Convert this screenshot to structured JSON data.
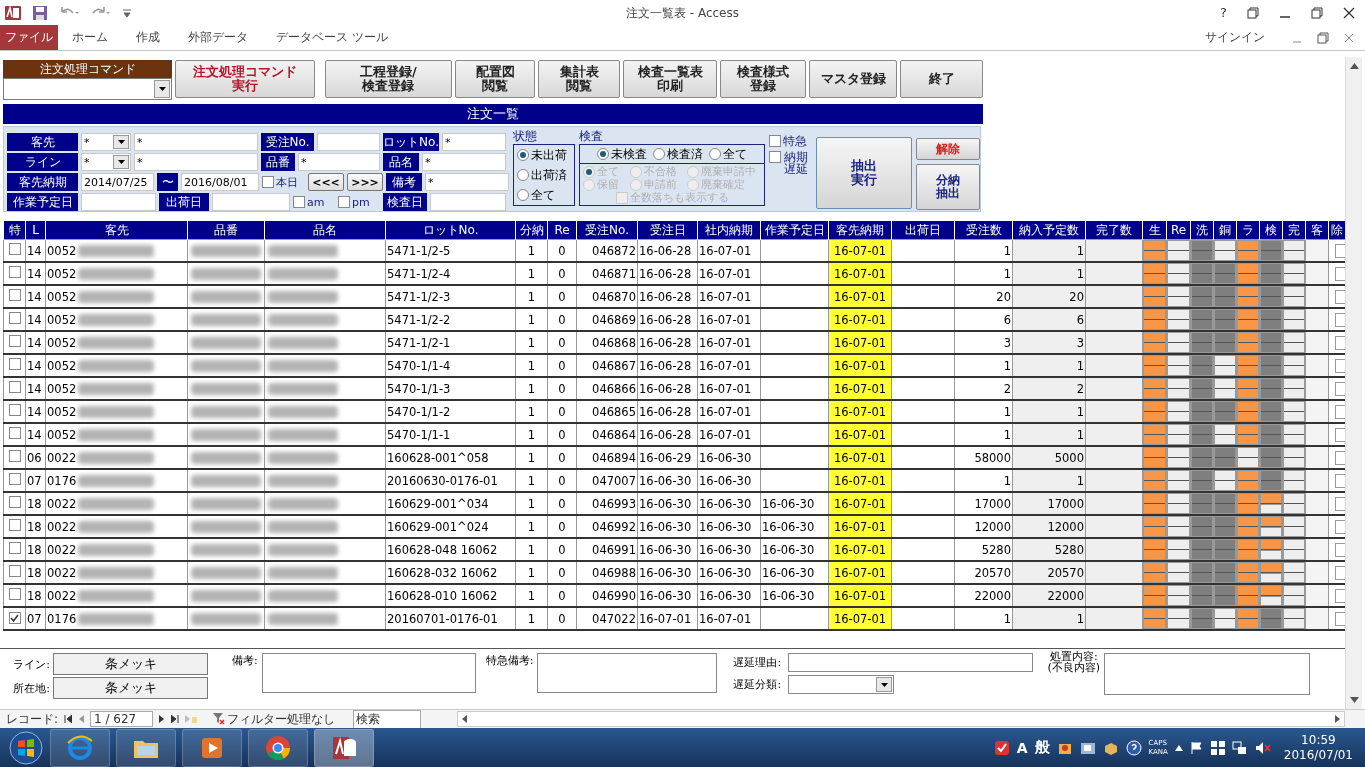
{
  "window": {
    "title": "注文一覧表 - Access",
    "help": "?",
    "signin": "サインイン"
  },
  "ribbon_tabs": [
    {
      "label": "ファイル",
      "selected": true
    },
    {
      "label": "ホーム",
      "selected": false
    },
    {
      "label": "作成",
      "selected": false
    },
    {
      "label": "外部データ",
      "selected": false
    },
    {
      "label": "データベース ツール",
      "selected": false
    }
  ],
  "command": {
    "label": "注文処理コマンド",
    "buttons": [
      {
        "label": "注文処理コマンド実行",
        "kind": "alert"
      },
      {
        "label": "工程登録/検査登録",
        "kind": "normal"
      },
      {
        "label": "配置図閲覧",
        "kind": "normal"
      },
      {
        "label": "集計表閲覧",
        "kind": "normal"
      },
      {
        "label": "検査一覧表印刷",
        "kind": "normal"
      },
      {
        "label": "検査様式登録",
        "kind": "normal"
      },
      {
        "label": "マスタ登録",
        "kind": "normal"
      },
      {
        "label": "終了",
        "kind": "normal"
      }
    ]
  },
  "form_title": "注文一覧",
  "filters": {
    "customer": {
      "label": "客先",
      "code": "*",
      "name": "*"
    },
    "line": {
      "label": "ライン",
      "code": "*",
      "name": "*"
    },
    "order_no": {
      "label": "受注No."
    },
    "lot_no": {
      "label": "ロットNo.",
      "value": "*"
    },
    "part_no": {
      "label": "品番",
      "value": "*"
    },
    "part_name": {
      "label": "品名",
      "value": "*"
    },
    "due": {
      "label": "客先納期",
      "from": "2014/07/25",
      "sep": "〜",
      "to": "2016/08/01"
    },
    "today": {
      "label": "本日",
      "checked": false
    },
    "prev": "<<<",
    "next": ">>>",
    "remarks": {
      "label": "備考",
      "value": "*"
    },
    "work_date": {
      "label": "作業予定日"
    },
    "ship_date": {
      "label": "出荷日"
    },
    "am": {
      "label": "am",
      "checked": false
    },
    "pm": {
      "label": "pm",
      "checked": false
    },
    "inspect_date": {
      "label": "検査日"
    }
  },
  "status": {
    "title": "状態",
    "options": [
      {
        "label": "未出荷",
        "selected": true
      },
      {
        "label": "出荷済",
        "selected": false
      },
      {
        "label": "全て",
        "selected": false
      }
    ]
  },
  "inspection": {
    "title": "検査",
    "options": [
      {
        "label": "未検査",
        "selected": true
      },
      {
        "label": "検査済",
        "selected": false
      },
      {
        "label": "全て",
        "selected": false
      }
    ],
    "detail": {
      "disabled": true,
      "options": [
        {
          "label": "全て",
          "selected": true
        },
        {
          "label": "不合格",
          "selected": false
        },
        {
          "label": "廃棄申請中",
          "selected": false
        },
        {
          "label": "保留",
          "selected": false
        },
        {
          "label": "申請前",
          "selected": false
        },
        {
          "label": "廃棄確定",
          "selected": false
        }
      ],
      "show_all": {
        "label": "全数落ちも表示する",
        "checked": false
      }
    }
  },
  "flags": [
    {
      "label": "特急",
      "checked": false
    },
    {
      "label": "納期遅延",
      "checked": false
    }
  ],
  "run_button": "抽出実行",
  "clear_button": "解除",
  "split_button": "分納抽出",
  "columns": [
    "特",
    "L",
    "客先",
    "品番",
    "品名",
    "ロットNo.",
    "分納",
    "Re",
    "受注No.",
    "受注日",
    "社内納期",
    "作業予定日",
    "客先納期",
    "出荷日",
    "受注数",
    "納入予定数",
    "完了数",
    "生",
    "Re",
    "洗",
    "銅",
    "ラ",
    "検",
    "完",
    "客",
    "除"
  ],
  "rows": [
    {
      "rush": false,
      "line": "14",
      "code": "0052",
      "lot": "5471-1/2-5",
      "split": "1",
      "re": "0",
      "order_no": "046872",
      "order_date": "16-06-28",
      "internal_due": "16-07-01",
      "customer_due": "16-07-01",
      "qty": "1",
      "planned": "1",
      "remove": false,
      "stages": [
        {
          "color": "#f79646"
        },
        {
          "color": "#eeeeee"
        },
        {
          "color": "#7f7f7f"
        },
        {
          "color": "#eeeeee"
        },
        {
          "color": "#f79646"
        },
        {
          "color": "#7f7f7f"
        },
        {
          "color": "#eeeeee"
        }
      ]
    },
    {
      "rush": false,
      "line": "14",
      "code": "0052",
      "lot": "5471-1/2-4",
      "split": "1",
      "re": "0",
      "order_no": "046871",
      "order_date": "16-06-28",
      "internal_due": "16-07-01",
      "customer_due": "16-07-01",
      "qty": "1",
      "planned": "1",
      "remove": false,
      "stages": [
        {
          "color": "#f79646"
        },
        {
          "color": "#eeeeee"
        },
        {
          "color": "#7f7f7f"
        },
        {
          "color": "#7f7f7f"
        },
        {
          "color": "#f79646"
        },
        {
          "color": "#7f7f7f"
        },
        {
          "color": "#eeeeee"
        }
      ]
    },
    {
      "rush": false,
      "line": "14",
      "code": "0052",
      "lot": "5471-1/2-3",
      "split": "1",
      "re": "0",
      "order_no": "046870",
      "order_date": "16-06-28",
      "internal_due": "16-07-01",
      "customer_due": "16-07-01",
      "qty": "20",
      "planned": "20",
      "remove": false,
      "stages": [
        {
          "color": "#f79646"
        },
        {
          "color": "#eeeeee"
        },
        {
          "color": "#7f7f7f"
        },
        {
          "color": "#7f7f7f"
        },
        {
          "color": "#f79646"
        },
        {
          "color": "#7f7f7f"
        },
        {
          "color": "#eeeeee"
        }
      ]
    },
    {
      "rush": false,
      "line": "14",
      "code": "0052",
      "lot": "5471-1/2-2",
      "split": "1",
      "re": "0",
      "order_no": "046869",
      "order_date": "16-06-28",
      "internal_due": "16-07-01",
      "customer_due": "16-07-01",
      "qty": "6",
      "planned": "6",
      "remove": false,
      "stages": [
        {
          "color": "#f79646"
        },
        {
          "color": "#eeeeee"
        },
        {
          "color": "#7f7f7f"
        },
        {
          "color": "#7f7f7f"
        },
        {
          "color": "#f79646"
        },
        {
          "color": "#7f7f7f"
        },
        {
          "color": "#eeeeee"
        }
      ]
    },
    {
      "rush": false,
      "line": "14",
      "code": "0052",
      "lot": "5471-1/2-1",
      "split": "1",
      "re": "0",
      "order_no": "046868",
      "order_date": "16-06-28",
      "internal_due": "16-07-01",
      "customer_due": "16-07-01",
      "qty": "3",
      "planned": "3",
      "remove": false,
      "stages": [
        {
          "color": "#f79646"
        },
        {
          "color": "#eeeeee"
        },
        {
          "color": "#7f7f7f"
        },
        {
          "color": "#7f7f7f"
        },
        {
          "color": "#f79646"
        },
        {
          "color": "#7f7f7f"
        },
        {
          "color": "#eeeeee"
        }
      ]
    },
    {
      "rush": false,
      "line": "14",
      "code": "0052",
      "lot": "5470-1/1-4",
      "split": "1",
      "re": "0",
      "order_no": "046867",
      "order_date": "16-06-28",
      "internal_due": "16-07-01",
      "customer_due": "16-07-01",
      "qty": "1",
      "planned": "1",
      "remove": false,
      "stages": [
        {
          "color": "#f79646"
        },
        {
          "color": "#eeeeee"
        },
        {
          "color": "#7f7f7f"
        },
        {
          "color": "#eeeeee"
        },
        {
          "color": "#f79646"
        },
        {
          "color": "#7f7f7f"
        },
        {
          "color": "#eeeeee"
        }
      ]
    },
    {
      "rush": false,
      "line": "14",
      "code": "0052",
      "lot": "5470-1/1-3",
      "split": "1",
      "re": "0",
      "order_no": "046866",
      "order_date": "16-06-28",
      "internal_due": "16-07-01",
      "customer_due": "16-07-01",
      "qty": "2",
      "planned": "2",
      "remove": false,
      "stages": [
        {
          "color": "#f79646"
        },
        {
          "color": "#eeeeee"
        },
        {
          "color": "#7f7f7f"
        },
        {
          "color": "#eeeeee"
        },
        {
          "color": "#f79646"
        },
        {
          "color": "#7f7f7f"
        },
        {
          "color": "#eeeeee"
        }
      ]
    },
    {
      "rush": false,
      "line": "14",
      "code": "0052",
      "lot": "5470-1/1-2",
      "split": "1",
      "re": "0",
      "order_no": "046865",
      "order_date": "16-06-28",
      "internal_due": "16-07-01",
      "customer_due": "16-07-01",
      "qty": "1",
      "planned": "1",
      "remove": false,
      "stages": [
        {
          "color": "#f79646"
        },
        {
          "color": "#eeeeee"
        },
        {
          "color": "#7f7f7f"
        },
        {
          "color": "#7f7f7f"
        },
        {
          "color": "#f79646"
        },
        {
          "color": "#7f7f7f"
        },
        {
          "color": "#eeeeee"
        }
      ]
    },
    {
      "rush": false,
      "line": "14",
      "code": "0052",
      "lot": "5470-1/1-1",
      "split": "1",
      "re": "0",
      "order_no": "046864",
      "order_date": "16-06-28",
      "internal_due": "16-07-01",
      "customer_due": "16-07-01",
      "qty": "1",
      "planned": "1",
      "remove": false,
      "stages": [
        {
          "color": "#f79646"
        },
        {
          "color": "#eeeeee"
        },
        {
          "color": "#7f7f7f"
        },
        {
          "color": "#eeeeee"
        },
        {
          "color": "#f79646"
        },
        {
          "color": "#7f7f7f"
        },
        {
          "color": "#eeeeee"
        }
      ]
    },
    {
      "rush": false,
      "line": "06",
      "code": "0022",
      "lot": "160628-001^058",
      "split": "1",
      "re": "0",
      "order_no": "046894",
      "order_date": "16-06-29",
      "internal_due": "16-06-30",
      "customer_due": "16-07-01",
      "qty": "58000",
      "planned": "5000",
      "remove": false,
      "stages": [
        {
          "color": "#f79646"
        },
        {
          "color": "#eeeeee"
        },
        {
          "color": "#7f7f7f"
        },
        {
          "color": "#7f7f7f"
        },
        {
          "color": "#eeeeee"
        },
        {
          "color": "#7f7f7f"
        },
        {
          "color": "#eeeeee"
        }
      ]
    },
    {
      "rush": false,
      "line": "07",
      "code": "0176",
      "lot": "20160630-0176-01",
      "split": "1",
      "re": "0",
      "order_no": "047007",
      "order_date": "16-06-30",
      "internal_due": "16-06-30",
      "customer_due": "16-07-01",
      "qty": "1",
      "planned": "1",
      "remove": false,
      "stages": [
        {
          "color": "#f79646"
        },
        {
          "color": "#eeeeee"
        },
        {
          "color": "#7f7f7f"
        },
        {
          "color": "#eeeeee"
        },
        {
          "color": "#f79646"
        },
        {
          "color": "#7f7f7f"
        },
        {
          "color": "#eeeeee"
        }
      ]
    },
    {
      "rush": false,
      "line": "18",
      "code": "0022",
      "lot": "160629-001^034",
      "split": "1",
      "re": "0",
      "order_no": "046993",
      "order_date": "16-06-30",
      "internal_due": "16-06-30",
      "work_date": "16-06-30",
      "customer_due": "16-07-01",
      "qty": "17000",
      "planned": "17000",
      "remove": false,
      "stages": [
        {
          "color": "#f79646"
        },
        {
          "color": "#eeeeee"
        },
        {
          "color": "#7f7f7f"
        },
        {
          "color": "#7f7f7f"
        },
        {
          "color": "#f79646"
        },
        {
          "halves": [
            {
              "color": "#f79646"
            },
            {
              "color": "#eeeeee"
            }
          ]
        },
        {
          "color": "#eeeeee"
        }
      ]
    },
    {
      "rush": false,
      "line": "18",
      "code": "0022",
      "lot": "160629-001^024",
      "split": "1",
      "re": "0",
      "order_no": "046992",
      "order_date": "16-06-30",
      "internal_due": "16-06-30",
      "work_date": "16-06-30",
      "customer_due": "16-07-01",
      "qty": "12000",
      "planned": "12000",
      "remove": false,
      "stages": [
        {
          "color": "#f79646"
        },
        {
          "color": "#eeeeee"
        },
        {
          "color": "#7f7f7f"
        },
        {
          "color": "#7f7f7f"
        },
        {
          "color": "#f79646"
        },
        {
          "halves": [
            {
              "color": "#f79646"
            },
            {
              "color": "#eeeeee"
            }
          ]
        },
        {
          "color": "#eeeeee"
        }
      ]
    },
    {
      "rush": false,
      "line": "18",
      "code": "0022",
      "lot": "160628-048 16062",
      "split": "1",
      "re": "0",
      "order_no": "046991",
      "order_date": "16-06-30",
      "internal_due": "16-06-30",
      "work_date": "16-06-30",
      "customer_due": "16-07-01",
      "qty": "5280",
      "planned": "5280",
      "remove": false,
      "stages": [
        {
          "color": "#f79646"
        },
        {
          "color": "#eeeeee"
        },
        {
          "color": "#7f7f7f"
        },
        {
          "color": "#7f7f7f"
        },
        {
          "color": "#f79646"
        },
        {
          "halves": [
            {
              "color": "#f79646"
            },
            {
              "color": "#eeeeee"
            }
          ]
        },
        {
          "color": "#eeeeee"
        }
      ]
    },
    {
      "rush": false,
      "line": "18",
      "code": "0022",
      "lot": "160628-032 16062",
      "split": "1",
      "re": "0",
      "order_no": "046988",
      "order_date": "16-06-30",
      "internal_due": "16-06-30",
      "work_date": "16-06-30",
      "customer_due": "16-07-01",
      "qty": "20570",
      "planned": "20570",
      "remove": false,
      "stages": [
        {
          "color": "#f79646"
        },
        {
          "color": "#eeeeee"
        },
        {
          "color": "#7f7f7f"
        },
        {
          "color": "#7f7f7f"
        },
        {
          "color": "#f79646"
        },
        {
          "halves": [
            {
              "color": "#f79646"
            },
            {
              "color": "#eeeeee"
            }
          ]
        },
        {
          "color": "#eeeeee"
        }
      ]
    },
    {
      "rush": false,
      "line": "18",
      "code": "0022",
      "lot": "160628-010 16062",
      "split": "1",
      "re": "0",
      "order_no": "046990",
      "order_date": "16-06-30",
      "internal_due": "16-06-30",
      "work_date": "16-06-30",
      "customer_due": "16-07-01",
      "qty": "22000",
      "planned": "22000",
      "remove": false,
      "stages": [
        {
          "color": "#f79646"
        },
        {
          "color": "#eeeeee"
        },
        {
          "color": "#7f7f7f"
        },
        {
          "color": "#7f7f7f"
        },
        {
          "color": "#f79646"
        },
        {
          "halves": [
            {
              "color": "#f79646"
            },
            {
              "color": "#eeeeee"
            }
          ]
        },
        {
          "color": "#eeeeee"
        }
      ]
    },
    {
      "rush": true,
      "line": "07",
      "code": "0176",
      "lot": "20160701-0176-01",
      "split": "1",
      "re": "0",
      "order_no": "047022",
      "order_date": "16-07-01",
      "internal_due": "16-07-01",
      "customer_due": "16-07-01",
      "qty": "1",
      "planned": "1",
      "remove": false,
      "stages": [
        {
          "color": "#f79646"
        },
        {
          "color": "#eeeeee"
        },
        {
          "color": "#7f7f7f"
        },
        {
          "color": "#eeeeee"
        },
        {
          "color": "#f79646"
        },
        {
          "color": "#7f7f7f"
        },
        {
          "color": "#eeeeee"
        }
      ]
    }
  ],
  "detail": {
    "line": {
      "label": "ライン:",
      "value": "条メッキ"
    },
    "location": {
      "label": "所在地:",
      "value": "条メッキ"
    },
    "remarks": "備考:",
    "rush_remarks": "特急備考:",
    "delay_reason": "遅延理由:",
    "delay_type": "遅延分類:",
    "action": "処置内容:\n(不良内容)"
  },
  "record_nav": {
    "label": "レコード:",
    "position": "1 / 627",
    "filter": "フィルター処理なし",
    "search": "検索"
  },
  "taskbar": {
    "ime": [
      "A",
      "般"
    ],
    "caps": "CAPS",
    "kana": "KANA",
    "time": "10:59",
    "date": "2016/07/01"
  }
}
